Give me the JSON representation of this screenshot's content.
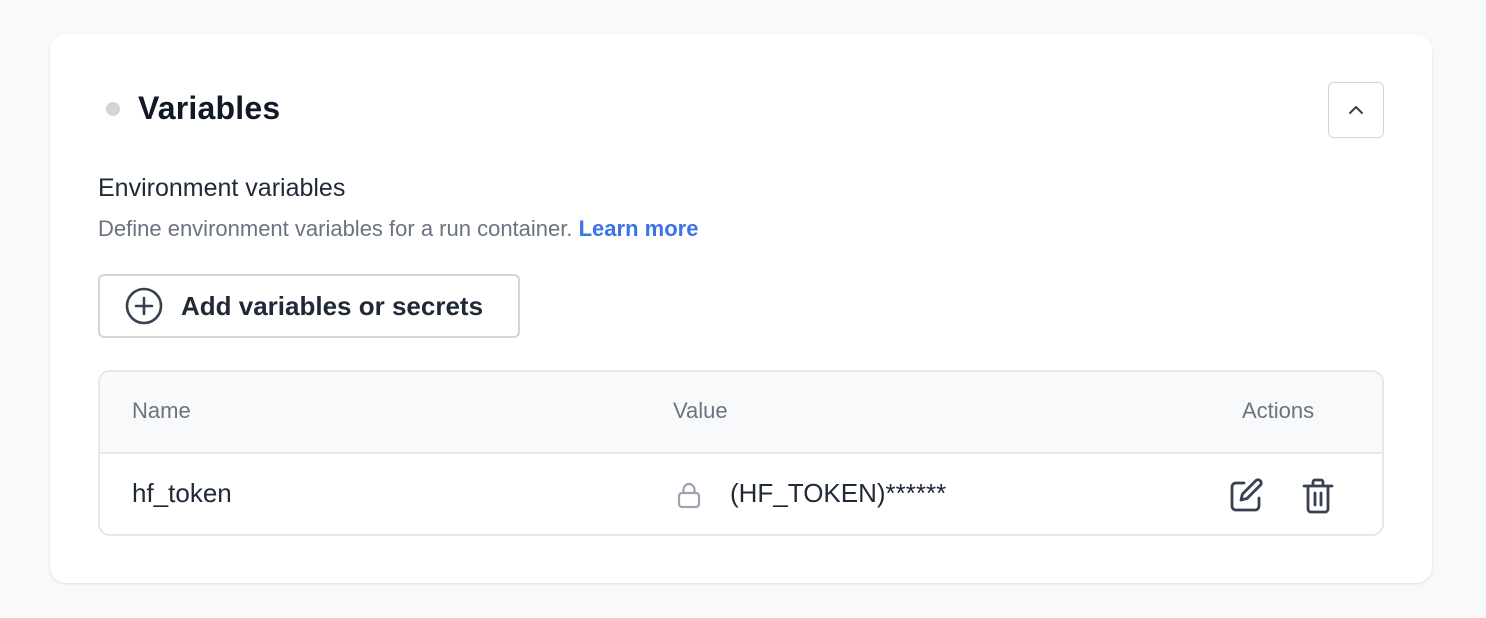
{
  "section": {
    "title": "Variables",
    "status": "inactive",
    "collapse_icon": "chevron-up-icon"
  },
  "env": {
    "title": "Environment variables",
    "description": "Define environment variables for a run container. ",
    "learn_more": "Learn more",
    "add_button": "Add variables or secrets",
    "add_icon": "plus-circle-icon"
  },
  "table": {
    "headers": {
      "name": "Name",
      "value": "Value",
      "actions": "Actions"
    },
    "rows": [
      {
        "name": "hf_token",
        "value": "(HF_TOKEN)******",
        "secret": true,
        "actions": [
          "edit-icon",
          "trash-icon"
        ]
      }
    ]
  },
  "colors": {
    "accent_link": "#3b74e6",
    "status_dot": "#d1d5db",
    "text_primary": "#1f2937",
    "text_muted": "#6b7280",
    "border": "#e5e7eb"
  }
}
